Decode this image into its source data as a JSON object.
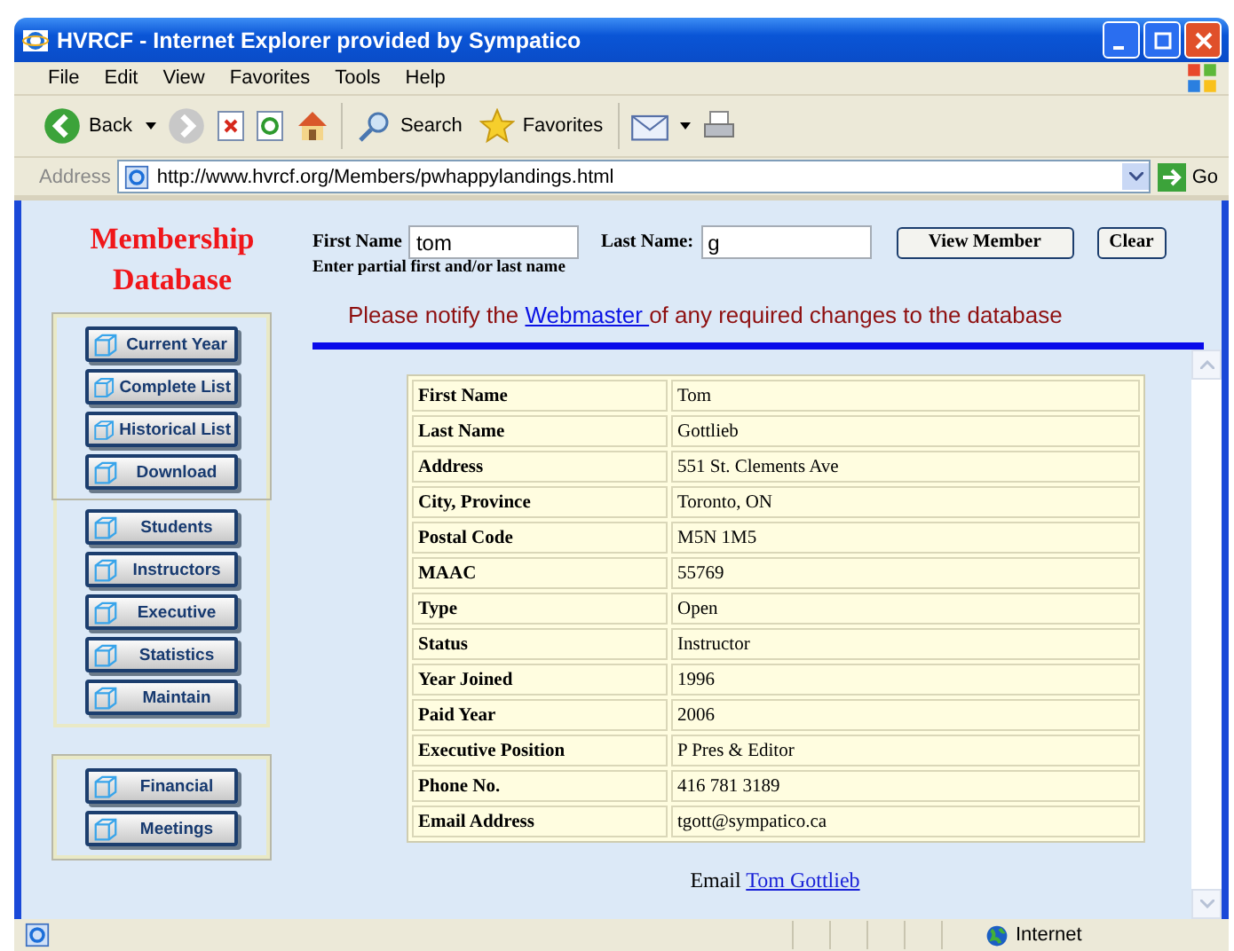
{
  "window": {
    "title": "HVRCF - Internet Explorer provided by Sympatico"
  },
  "menu": [
    "File",
    "Edit",
    "View",
    "Favorites",
    "Tools",
    "Help"
  ],
  "toolbar": {
    "back": "Back",
    "search": "Search",
    "favorites": "Favorites"
  },
  "address": {
    "label": "Address",
    "url": "http://www.hvrcf.org/Members/pwhappylandings.html",
    "go": "Go"
  },
  "sidebar": {
    "title_lines": [
      "Membership",
      "Database"
    ],
    "groups": [
      [
        "Current Year",
        "Complete List",
        "Historical List",
        "Download"
      ],
      [
        "Students",
        "Instructors",
        "Executive",
        "Statistics",
        "Maintain"
      ],
      [
        "Financial",
        "Meetings"
      ]
    ]
  },
  "search": {
    "first_label": "First Name",
    "first_value": "tom",
    "last_label": "Last Name:",
    "last_value": "g",
    "hint": "Enter partial first and/or last name",
    "view_button": "View  Member",
    "clear_button": "Clear"
  },
  "notice": {
    "before": "Please notify the ",
    "link": "Webmaster ",
    "after": "of any required changes to the database"
  },
  "table": {
    "rows": [
      {
        "label": "First Name",
        "value": "Tom"
      },
      {
        "label": "Last Name",
        "value": "Gottlieb"
      },
      {
        "label": "Address",
        "value": "551 St. Clements Ave"
      },
      {
        "label": "City, Province",
        "value": "Toronto, ON"
      },
      {
        "label": "Postal Code",
        "value": "M5N 1M5"
      },
      {
        "label": "MAAC",
        "value": "55769"
      },
      {
        "label": "Type",
        "value": "Open"
      },
      {
        "label": "Status",
        "value": "Instructor"
      },
      {
        "label": "Year Joined",
        "value": "1996"
      },
      {
        "label": "Paid Year",
        "value": "2006"
      },
      {
        "label": "Executive Position",
        "value": "P Pres & Editor"
      },
      {
        "label": "Phone No.",
        "value": "416 781 3189"
      },
      {
        "label": "Email Address",
        "value": "tgott@sympatico.ca"
      }
    ]
  },
  "email": {
    "label": "Email",
    "link": "Tom Gottlieb"
  },
  "status_bar": {
    "zone": "Internet"
  }
}
